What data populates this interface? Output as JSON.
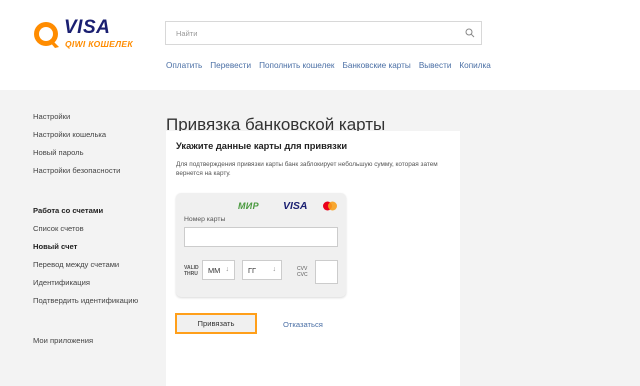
{
  "logo": {
    "visa": "VISA",
    "sub": "QIWI КОШЕЛЕК"
  },
  "search": {
    "placeholder": "Найти"
  },
  "nav": [
    "Оплатить",
    "Перевести",
    "Пополнить кошелек",
    "Банковские карты",
    "Вывести",
    "Копилка"
  ],
  "sidebar": {
    "group1": [
      "Настройки",
      "Настройки кошелька",
      "Новый пароль",
      "Настройки безопасности"
    ],
    "group2_title": "Работа со счетами",
    "group2": [
      "Список счетов"
    ],
    "group2_active": "Новый счет",
    "group2_rest": [
      "Перевод между счетами",
      "Идентификация",
      "Подтвердить идентификацию"
    ],
    "group3": [
      "Мои приложения"
    ]
  },
  "page": {
    "title": "Привязка банковской карты"
  },
  "card": {
    "heading": "Укажите данные карты для привязки",
    "description": "Для подтверждения привязки карты банк заблокирует небольшую сумму, которая затем вернется на карту.",
    "brands": {
      "mir": "МИР",
      "visa": "VISA"
    },
    "card_number_label": "Номер карты",
    "valid_thru": "VALID THRU",
    "month": "ММ",
    "year": "ГГ",
    "cvv": "CVV CVC",
    "bind_button": "Привязать",
    "cancel_link": "Отказаться"
  },
  "colors": {
    "accent": "#ff9f1a",
    "link": "#4a6fa5",
    "background": "#f3f3f3"
  }
}
